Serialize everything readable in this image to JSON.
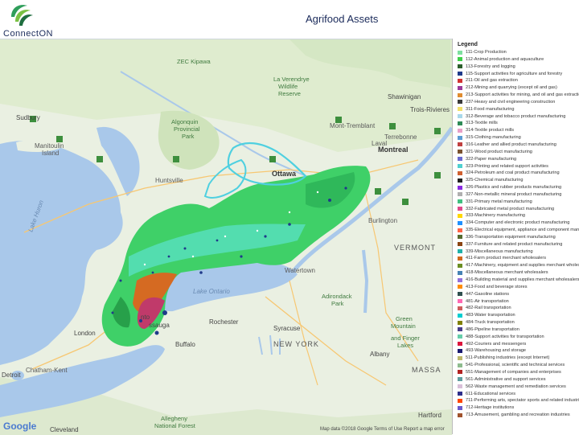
{
  "header": {
    "logo_text": "ConnectON",
    "title": "Agrifood Assets"
  },
  "map": {
    "attribution": "Map data ©2018 Google    Terms of Use    Report a map error",
    "provider": "Google",
    "places": [
      {
        "id": "zec",
        "text": "ZEC Kipawa"
      },
      {
        "id": "verendrye",
        "text": "La Verendrye"
      },
      {
        "id": "verendrye2",
        "text": "Wildlife"
      },
      {
        "id": "verendrye3",
        "text": "Reserve"
      },
      {
        "id": "sudbury",
        "text": "Sudbury"
      },
      {
        "id": "shawinigan",
        "text": "Shawinigan"
      },
      {
        "id": "trois",
        "text": "Trois-Rivieres"
      },
      {
        "id": "mont",
        "text": "Mont-Tremblant"
      },
      {
        "id": "algonquin",
        "text": "Algonquin"
      },
      {
        "id": "algonquin2",
        "text": "Provincial"
      },
      {
        "id": "algonquin3",
        "text": "Park"
      },
      {
        "id": "manitoulin",
        "text": "Manitoulin"
      },
      {
        "id": "manitoulin2",
        "text": "Island"
      },
      {
        "id": "huntsville",
        "text": "Huntsville"
      },
      {
        "id": "ottawa",
        "text": "Ottawa"
      },
      {
        "id": "montreal",
        "text": "Montreal"
      },
      {
        "id": "terrebonne",
        "text": "Terrebonne"
      },
      {
        "id": "laval",
        "text": "Laval"
      },
      {
        "id": "vermont",
        "text": "VERMONT"
      },
      {
        "id": "watertown",
        "text": "Watertown"
      },
      {
        "id": "burlington",
        "text": "Burlington"
      },
      {
        "id": "lakeontario",
        "text": "Lake Ontario"
      },
      {
        "id": "lakehuron",
        "text": "Lake Huron"
      },
      {
        "id": "mississauga",
        "text": "ssauga"
      },
      {
        "id": "toronto",
        "text": "nto"
      },
      {
        "id": "london",
        "text": "London"
      },
      {
        "id": "rochester",
        "text": "Rochester"
      },
      {
        "id": "buffalo",
        "text": "Buffalo"
      },
      {
        "id": "syracuse",
        "text": "Syracuse"
      },
      {
        "id": "newyork",
        "text": "NEW YORK"
      },
      {
        "id": "adirondack",
        "text": "Adirondack"
      },
      {
        "id": "adirondack2",
        "text": "Park"
      },
      {
        "id": "greenmtn",
        "text": "Green"
      },
      {
        "id": "greenmtn2",
        "text": "Mountain"
      },
      {
        "id": "greenmtn3",
        "text": "and Finger"
      },
      {
        "id": "greenmtn4",
        "text": "Lakes"
      },
      {
        "id": "albany",
        "text": "Albany"
      },
      {
        "id": "massa",
        "text": "MASSA"
      },
      {
        "id": "detroit",
        "text": "Detroit"
      },
      {
        "id": "chatham",
        "text": "Chatham-Kent"
      },
      {
        "id": "cleveland",
        "text": "Cleveland"
      },
      {
        "id": "hartford",
        "text": "Hartford"
      },
      {
        "id": "allegheny",
        "text": "Allegheny"
      },
      {
        "id": "allegheny2",
        "text": "National Forest"
      }
    ]
  },
  "legend": {
    "title": "Legend",
    "items": [
      {
        "label": "111-Crop Production",
        "color": "#7ee0a0"
      },
      {
        "label": "112-Animal production and aquaculture",
        "color": "#3fd04a"
      },
      {
        "label": "113-Forestry and logging",
        "color": "#2c5f2c"
      },
      {
        "label": "115-Support activities for agriculture and forestry",
        "color": "#1f3a8a"
      },
      {
        "label": "211-Oil and gas extraction",
        "color": "#d23232"
      },
      {
        "label": "212-Mining and quarrying (except oil and gas)",
        "color": "#9b3b9b"
      },
      {
        "label": "213-Support activities for mining, and oil and gas extraction",
        "color": "#e08c30"
      },
      {
        "label": "237-Heavy and civil engineering construction",
        "color": "#3a3a3a"
      },
      {
        "label": "311-Food manufacturing",
        "color": "#f2e06a"
      },
      {
        "label": "312-Beverage and tobacco product manufacturing",
        "color": "#a8d8ea"
      },
      {
        "label": "313-Textile mills",
        "color": "#2e8b57"
      },
      {
        "label": "314-Textile product mills",
        "color": "#e8a0c8"
      },
      {
        "label": "315-Clothing manufacturing",
        "color": "#5a9bd4"
      },
      {
        "label": "316-Leather and allied product manufacturing",
        "color": "#c04040"
      },
      {
        "label": "321-Wood product manufacturing",
        "color": "#7a5230"
      },
      {
        "label": "322-Paper manufacturing",
        "color": "#6a6ad0"
      },
      {
        "label": "323-Printing and related support activities",
        "color": "#4fd0d0"
      },
      {
        "label": "324-Petroleum and coal product manufacturing",
        "color": "#d06030"
      },
      {
        "label": "325-Chemical manufacturing",
        "color": "#202020"
      },
      {
        "label": "326-Plastics and rubber products manufacturing",
        "color": "#8a2be2"
      },
      {
        "label": "327-Non-metallic mineral product manufacturing",
        "color": "#b0b0b0"
      },
      {
        "label": "331-Primary metal manufacturing",
        "color": "#40c080"
      },
      {
        "label": "332-Fabricated metal product manufacturing",
        "color": "#e04a8a"
      },
      {
        "label": "333-Machinery manufacturing",
        "color": "#ffd700"
      },
      {
        "label": "334-Computer and electronic product manufacturing",
        "color": "#1e90ff"
      },
      {
        "label": "335-Electrical equipment, appliance and component manufacturing",
        "color": "#ff6347"
      },
      {
        "label": "336-Transportation equipment manufacturing",
        "color": "#556b2f"
      },
      {
        "label": "337-Furniture and related product manufacturing",
        "color": "#8b4513"
      },
      {
        "label": "339-Miscellaneous manufacturing",
        "color": "#20b2aa"
      },
      {
        "label": "411-Farm product merchant wholesalers",
        "color": "#d2691e"
      },
      {
        "label": "417-Machinery, equipment and supplies merchant wholesalers",
        "color": "#6b8e23"
      },
      {
        "label": "418-Miscellaneous merchant wholesalers",
        "color": "#4682b4"
      },
      {
        "label": "416-Building material and supplies merchant wholesalers",
        "color": "#9370db"
      },
      {
        "label": "413-Food and beverage stores",
        "color": "#ff8c00"
      },
      {
        "label": "447-Gasoline stations",
        "color": "#2f4f4f"
      },
      {
        "label": "481-Air transportation",
        "color": "#ff69b4"
      },
      {
        "label": "482-Rail transportation",
        "color": "#cd5c5c"
      },
      {
        "label": "483-Water transportation",
        "color": "#00ced1"
      },
      {
        "label": "484-Truck transportation",
        "color": "#808000"
      },
      {
        "label": "486-Pipeline transportation",
        "color": "#483d8b"
      },
      {
        "label": "488-Support activities for transportation",
        "color": "#66cdaa"
      },
      {
        "label": "492-Couriers and messengers",
        "color": "#dc143c"
      },
      {
        "label": "493-Warehousing and storage",
        "color": "#191970"
      },
      {
        "label": "511-Publishing industries (except Internet)",
        "color": "#bdb76b"
      },
      {
        "label": "541-Professional, scientific and technical services",
        "color": "#8fbc8f"
      },
      {
        "label": "551-Management of companies and enterprises",
        "color": "#b22222"
      },
      {
        "label": "561-Administrative and support services",
        "color": "#5f9ea0"
      },
      {
        "label": "562-Waste management and remediation services",
        "color": "#d8bfd8"
      },
      {
        "label": "611-Educational services",
        "color": "#2e2e8a"
      },
      {
        "label": "711-Performing arts, spectator sports and related industries",
        "color": "#ff4500"
      },
      {
        "label": "712-Heritage institutions",
        "color": "#6a5acd"
      },
      {
        "label": "713-Amusement, gambling and recreation industries",
        "color": "#a0522d"
      }
    ]
  }
}
